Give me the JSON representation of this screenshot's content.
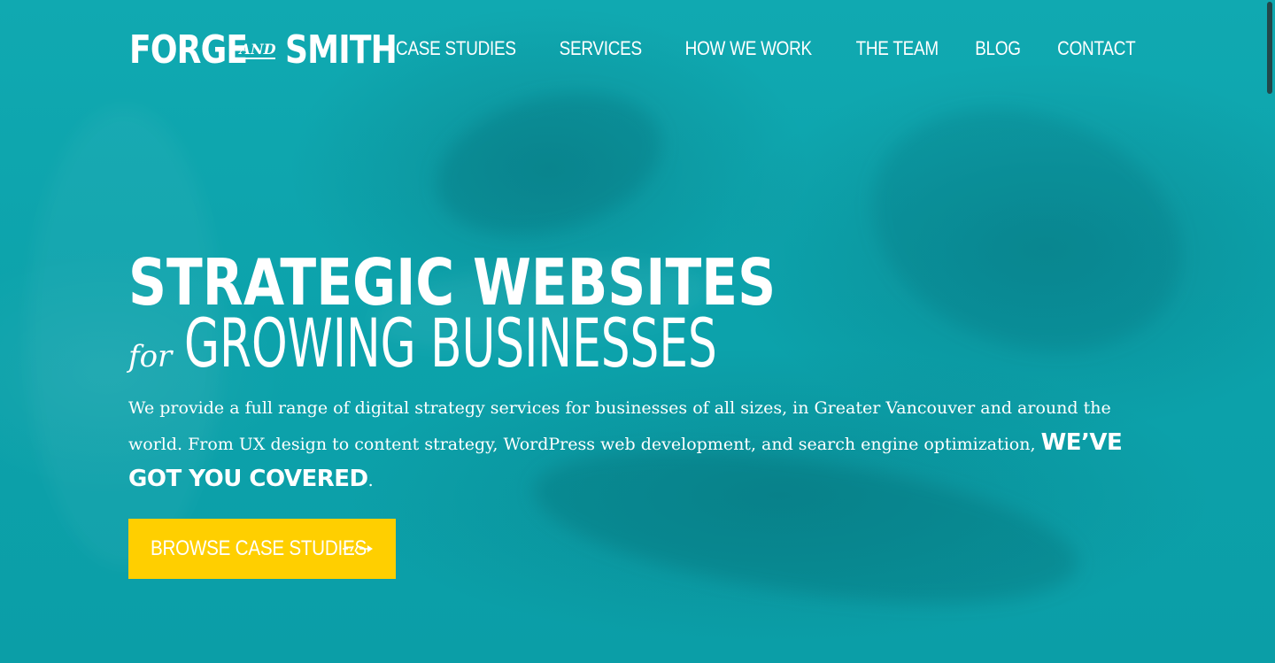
{
  "brand": {
    "logo_part1": "FORGE",
    "logo_and": "AND",
    "logo_part2": "SMITH"
  },
  "nav": {
    "items": [
      {
        "label": "CASE STUDIES"
      },
      {
        "label": "SERVICES"
      },
      {
        "label": "HOW WE WORK"
      },
      {
        "label": "THE TEAM"
      },
      {
        "label": "BLOG"
      },
      {
        "label": "CONTACT"
      }
    ]
  },
  "hero": {
    "headline_line1": "STRATEGIC WEBSITES",
    "headline_for": "for",
    "headline_line2": "GROWING BUSINESSES",
    "intro_text": "We provide a full range of digital strategy services for businesses of all sizes, in Greater Vancouver and around the world. From UX design to content strategy, WordPress web development, and search engine optimization, ",
    "intro_emphasis": "WE’VE GOT YOU COVERED",
    "intro_end": "."
  },
  "cta": {
    "label": "BROWSE CASE STUDIES",
    "icon": "arrow-right-icon"
  },
  "colors": {
    "background": "#0aa3ac",
    "cta_background": "#ffcf00",
    "text": "#ffffff"
  }
}
